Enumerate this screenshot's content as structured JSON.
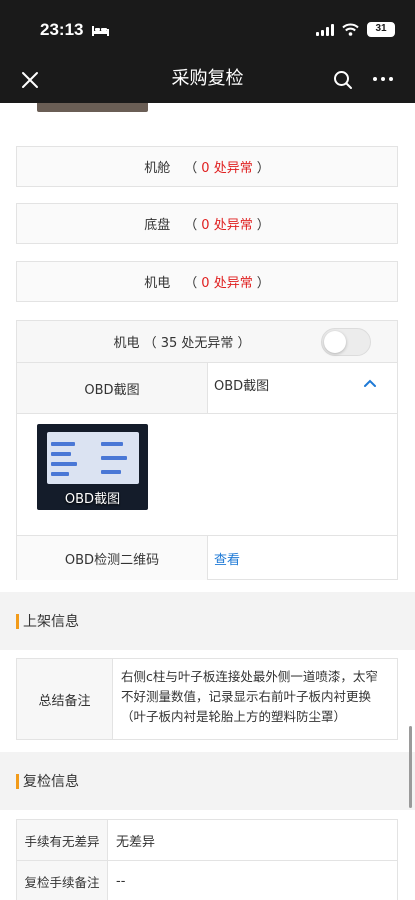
{
  "status_bar": {
    "time": "23:13",
    "battery": "31"
  },
  "nav": {
    "title": "采购复检"
  },
  "categories": [
    {
      "name": "机舱",
      "open": "（",
      "count_text": "0 处异常",
      "close": "）"
    },
    {
      "name": "底盘",
      "open": "（",
      "count_text": "0 处异常",
      "close": "）"
    },
    {
      "name": "机电",
      "open": "（",
      "count_text": "0 处异常",
      "close": "）"
    }
  ],
  "obd_section": {
    "header": "机电 （ 35 处无异常 ）",
    "toggle_on": false,
    "screenshot_label": "OBD截图",
    "screenshot_value": "OBD截图",
    "image_caption": "OBD截图",
    "qr_label": "OBD检测二维码",
    "qr_link": "查看"
  },
  "listing_section": {
    "title": "上架信息",
    "summary_label": "总结备注",
    "summary_text": "右侧c柱与叶子板连接处最外侧一道喷漆，太窄不好测量数值，记录显示右前叶子板内衬更换（叶子板内衬是轮胎上方的塑料防尘罩）"
  },
  "recheck_section": {
    "title": "复检信息",
    "rows": [
      {
        "label": "手续有无差异",
        "value": "无差异"
      },
      {
        "label": "复检手续备注",
        "value": "--"
      }
    ]
  },
  "colors": {
    "accent_orange": "#f29b1a",
    "alert_red": "#e02020",
    "link_blue": "#1f7ad6"
  }
}
